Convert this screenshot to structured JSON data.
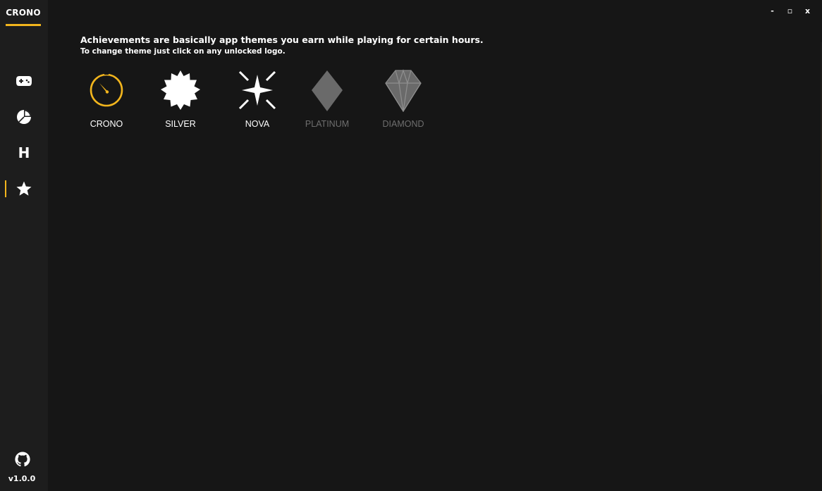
{
  "app": {
    "title": "CRONO",
    "version": "v1.0.0",
    "accent": "#f2b51d"
  },
  "sidebar": {
    "items": [
      {
        "name": "games",
        "icon": "gamepad-icon",
        "active": false
      },
      {
        "name": "stats",
        "icon": "pie-chart-icon",
        "active": false
      },
      {
        "name": "hours",
        "icon": "h-letter-icon",
        "label": "H",
        "active": false
      },
      {
        "name": "achievements",
        "icon": "star-icon",
        "active": true
      }
    ],
    "github_icon": "github-icon"
  },
  "window_controls": {
    "minimize": "-",
    "maximize": "▫",
    "close": "x"
  },
  "intro": {
    "line1": "Achievements are basically app themes you earn while playing for certain hours.",
    "line2": "To change theme just click on any unlocked logo."
  },
  "themes": [
    {
      "label": "CRONO",
      "icon": "crono-clock-icon",
      "locked": false
    },
    {
      "label": "SILVER",
      "icon": "silver-badge-icon",
      "locked": false
    },
    {
      "label": "NOVA",
      "icon": "nova-star-icon",
      "locked": false
    },
    {
      "label": "PLATINUM",
      "icon": "platinum-gem-icon",
      "locked": true
    },
    {
      "label": "DIAMOND",
      "icon": "diamond-gem-icon",
      "locked": true
    }
  ]
}
